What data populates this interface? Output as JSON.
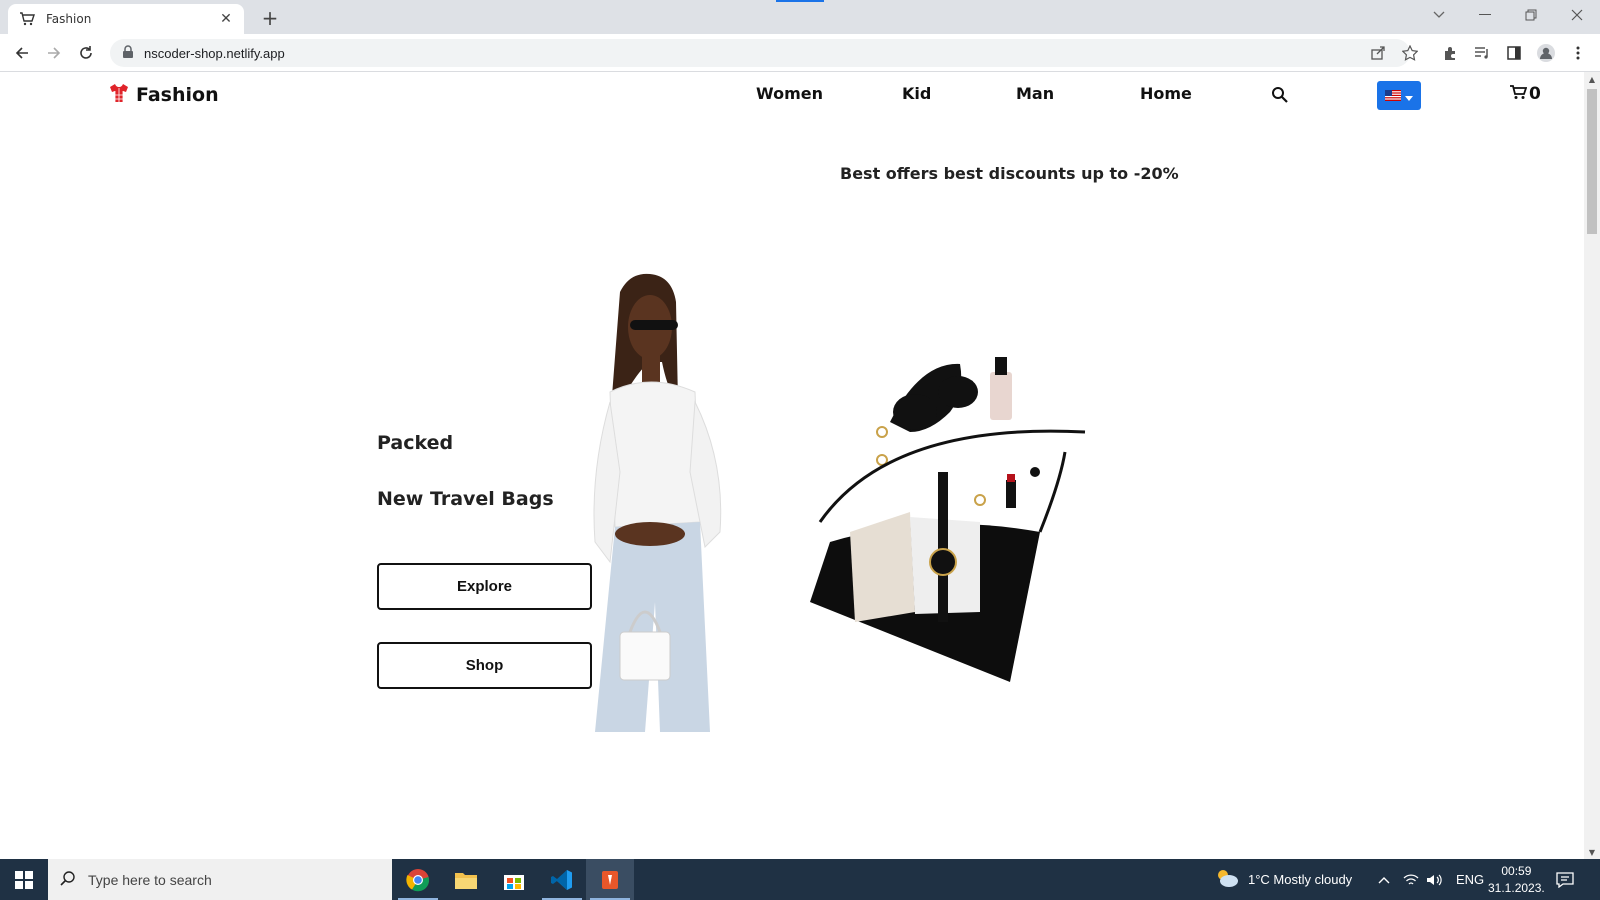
{
  "browser": {
    "tab_title": "Fashion",
    "tab_close_glyph": "✕",
    "new_tab_glyph": "+",
    "url": "nscoder-shop.netlify.app"
  },
  "site": {
    "brand": "Fashion",
    "nav": [
      {
        "label": "Women"
      },
      {
        "label": "Kid"
      },
      {
        "label": "Man"
      },
      {
        "label": "Home"
      }
    ],
    "cart_count": "0",
    "promo": "Best offers best discounts up to -20%",
    "hero": {
      "line1": "Packed",
      "line2": "New Travel Bags",
      "explore_label": "Explore",
      "shop_label": "Shop"
    },
    "accent_color": "#1a73e8",
    "logo_color": "#e0242a"
  },
  "taskbar": {
    "search_placeholder": "Type here to search",
    "weather": "1°C  Mostly cloudy",
    "language": "ENG",
    "time": "00:59",
    "date": "31.1.2023."
  }
}
